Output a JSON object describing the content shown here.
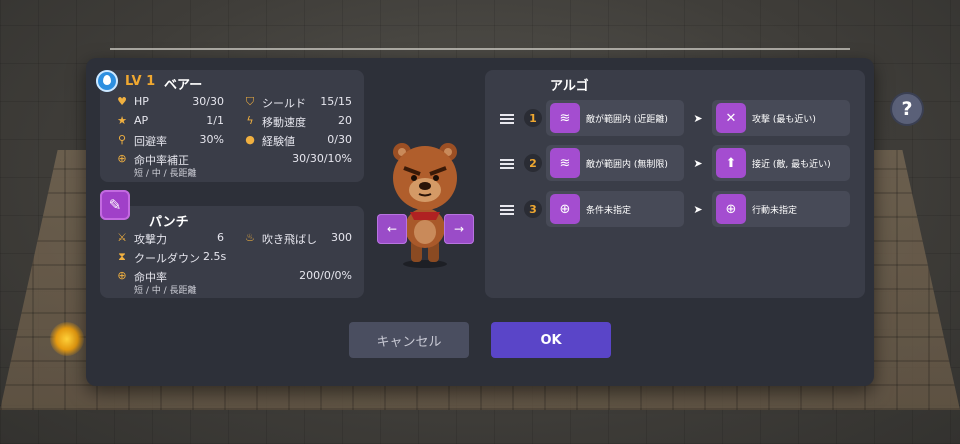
{
  "help_label": "?",
  "character": {
    "level": "LV 1",
    "name": "ベアー",
    "element_icon": "water-drop-icon",
    "stats": [
      {
        "label": "HP",
        "value": "30/30",
        "icon": "heart-icon"
      },
      {
        "label": "シールド",
        "value": "15/15",
        "icon": "shield-icon"
      },
      {
        "label": "AP",
        "value": "1/1",
        "icon": "star-icon"
      },
      {
        "label": "移動速度",
        "value": "20",
        "icon": "lightning-icon"
      },
      {
        "label": "回避率",
        "value": "30%",
        "icon": "runner-icon"
      },
      {
        "label": "経験値",
        "value": "0/30",
        "icon": "medal-icon"
      }
    ],
    "accuracy_label": "命中率補正",
    "accuracy_value": "30/30/10%",
    "accuracy_sub": "短 / 中 / 長距離"
  },
  "skill": {
    "name": "パンチ",
    "attack_label": "攻撃力",
    "attack_value": "6",
    "knockback_label": "吹き飛ばし",
    "knockback_value": "300",
    "cooldown_label": "クールダウン",
    "cooldown_value": "2.5s",
    "accuracy_label": "命中率",
    "accuracy_value": "200/0/0%",
    "accuracy_sub": "短 / 中 / 長距離"
  },
  "nav": {
    "prev_label": "←",
    "next_label": "→"
  },
  "ai": {
    "title": "アルゴ",
    "rows": [
      {
        "num": "1",
        "condition": "敵が範囲内 (近距離)",
        "condition_icon": "wifi-range-icon",
        "action": "攻撃 (最も近い)",
        "action_icon": "attack-icon"
      },
      {
        "num": "2",
        "condition": "敵が範囲内 (無制限)",
        "condition_icon": "wifi-range-icon",
        "action": "接近 (敵, 最も近い)",
        "action_icon": "arrow-up-icon"
      },
      {
        "num": "3",
        "condition": "条件未指定",
        "condition_icon": "plus-circle-icon",
        "action": "行動未指定",
        "action_icon": "plus-circle-icon"
      }
    ]
  },
  "buttons": {
    "cancel": "キャンセル",
    "ok": "OK"
  },
  "colors": {
    "accent": "#a44dd0",
    "level": "#f0a830",
    "ok": "#5a45c8"
  }
}
